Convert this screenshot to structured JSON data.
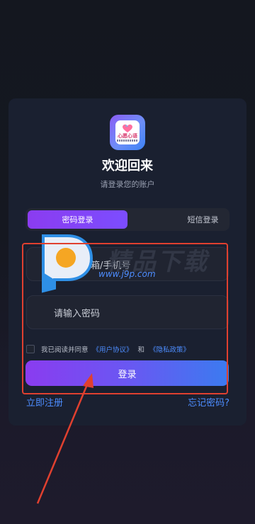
{
  "app": {
    "logo_text": "心愿心语",
    "title": "欢迎回来",
    "subtitle": "请登录您的账户"
  },
  "tabs": [
    {
      "label": "密码登录",
      "active": true
    },
    {
      "label": "短信登录",
      "active": false
    }
  ],
  "form": {
    "account_placeholder": "请输入邮箱/手机号",
    "password_placeholder": "请输入密码",
    "agree_prefix": "我已阅读并同意",
    "user_agreement": "《用户协议》",
    "and": "和",
    "privacy_policy": "《隐私政策》",
    "login_button": "登录"
  },
  "footer": {
    "register": "立即注册",
    "forgot_password": "忘记密码?"
  },
  "watermark": {
    "text": "精品下载",
    "url": "www.j9p.com"
  },
  "colors": {
    "accent_purple": "#8b3cf0",
    "accent_blue": "#3b7bf0",
    "link": "#4d8dff",
    "annotation_red": "#e0402f"
  }
}
